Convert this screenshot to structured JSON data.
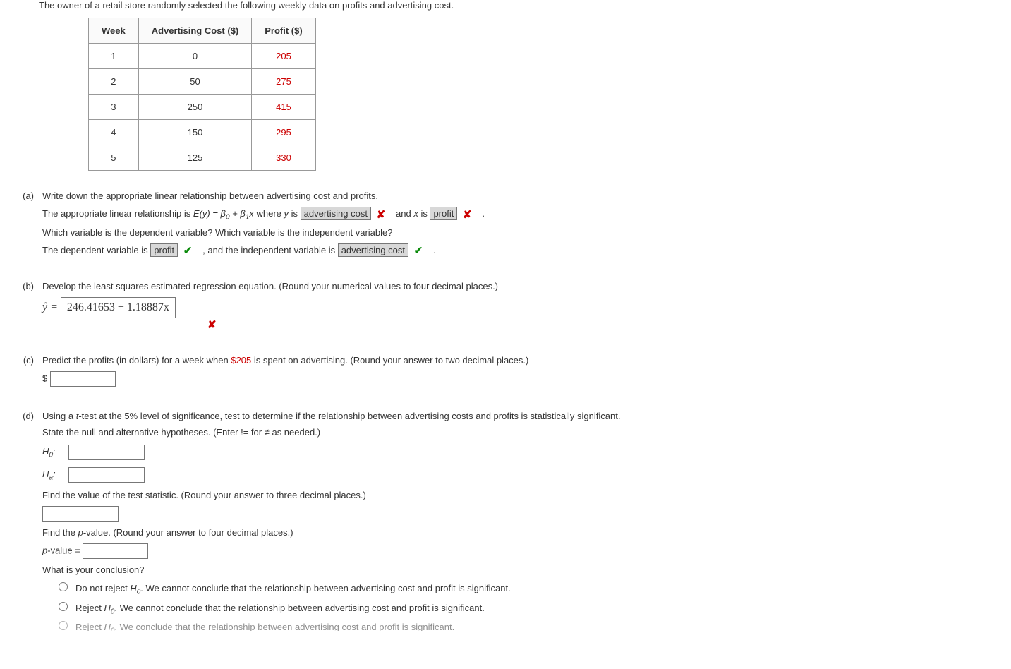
{
  "intro": "The owner of a retail store randomly selected the following weekly data on profits and advertising cost.",
  "table": {
    "headers": [
      "Week",
      "Advertising Cost ($)",
      "Profit ($)"
    ],
    "rows": [
      {
        "week": "1",
        "cost": "0",
        "profit": "205"
      },
      {
        "week": "2",
        "cost": "50",
        "profit": "275"
      },
      {
        "week": "3",
        "cost": "250",
        "profit": "415"
      },
      {
        "week": "4",
        "cost": "150",
        "profit": "295"
      },
      {
        "week": "5",
        "cost": "125",
        "profit": "330"
      }
    ]
  },
  "parts": {
    "a": {
      "label": "(a)",
      "q1": "Write down the appropriate linear relationship between advertising cost and profits.",
      "line1_pre": "The appropriate linear relationship is ",
      "line1_eqn_part1": "E(y) = β",
      "line1_eqn_part2": " + β",
      "line1_eqn_part3": "x",
      "line1_mid1": " where ",
      "y_is": "y",
      "is_text": " is ",
      "ans_y": "advertising cost",
      "and_text": "and ",
      "x_is": "x",
      "ans_x": "profit",
      "period": ".",
      "q2": "Which variable is the dependent variable? Which variable is the independent variable?",
      "dep_pre": "The dependent variable is ",
      "ans_dep": "profit",
      "indep_mid": ", and the independent variable is ",
      "ans_indep": "advertising cost"
    },
    "b": {
      "label": "(b)",
      "q": "Develop the least squares estimated regression equation. (Round your numerical values to four decimal places.)",
      "yhat": "ŷ",
      "equals": " = ",
      "answer": "246.41653 + 1.18887x"
    },
    "c": {
      "label": "(c)",
      "q_pre": "Predict the profits (in dollars) for a week when ",
      "amount": "$205",
      "q_post": " is spent on advertising. (Round your answer to two decimal places.)",
      "dollar": "$"
    },
    "d": {
      "label": "(d)",
      "q1_pre": "Using a ",
      "t": "t",
      "q1_post": "-test at the 5% level of significance, test to determine if the relationship between advertising costs and profits is statistically significant.",
      "q2": "State the null and alternative hypotheses. (Enter != for ≠ as needed.)",
      "h0": "H",
      "h0_sub": "0",
      "ha": "H",
      "ha_sub": "a",
      "colon": ":",
      "find_ts": "Find the value of the test statistic. (Round your answer to three decimal places.)",
      "find_p_pre": "Find the ",
      "pval_label_it": "p",
      "find_p_post": "-value. (Round your answer to four decimal places.)",
      "pval_eq_it": "p",
      "pval_eq_rest": "-value = ",
      "conclusion_q": "What is your conclusion?",
      "opt1_pre": "Do not reject ",
      "opt1_post": ". We cannot conclude that the relationship between advertising cost and profit is significant.",
      "opt2_pre": "Reject ",
      "opt2_post": ". We cannot conclude that the relationship between advertising cost and profit is significant.",
      "opt3_pre": "Reject ",
      "opt3_post": ". We conclude that the relationship between advertising cost and profit is significant."
    }
  }
}
